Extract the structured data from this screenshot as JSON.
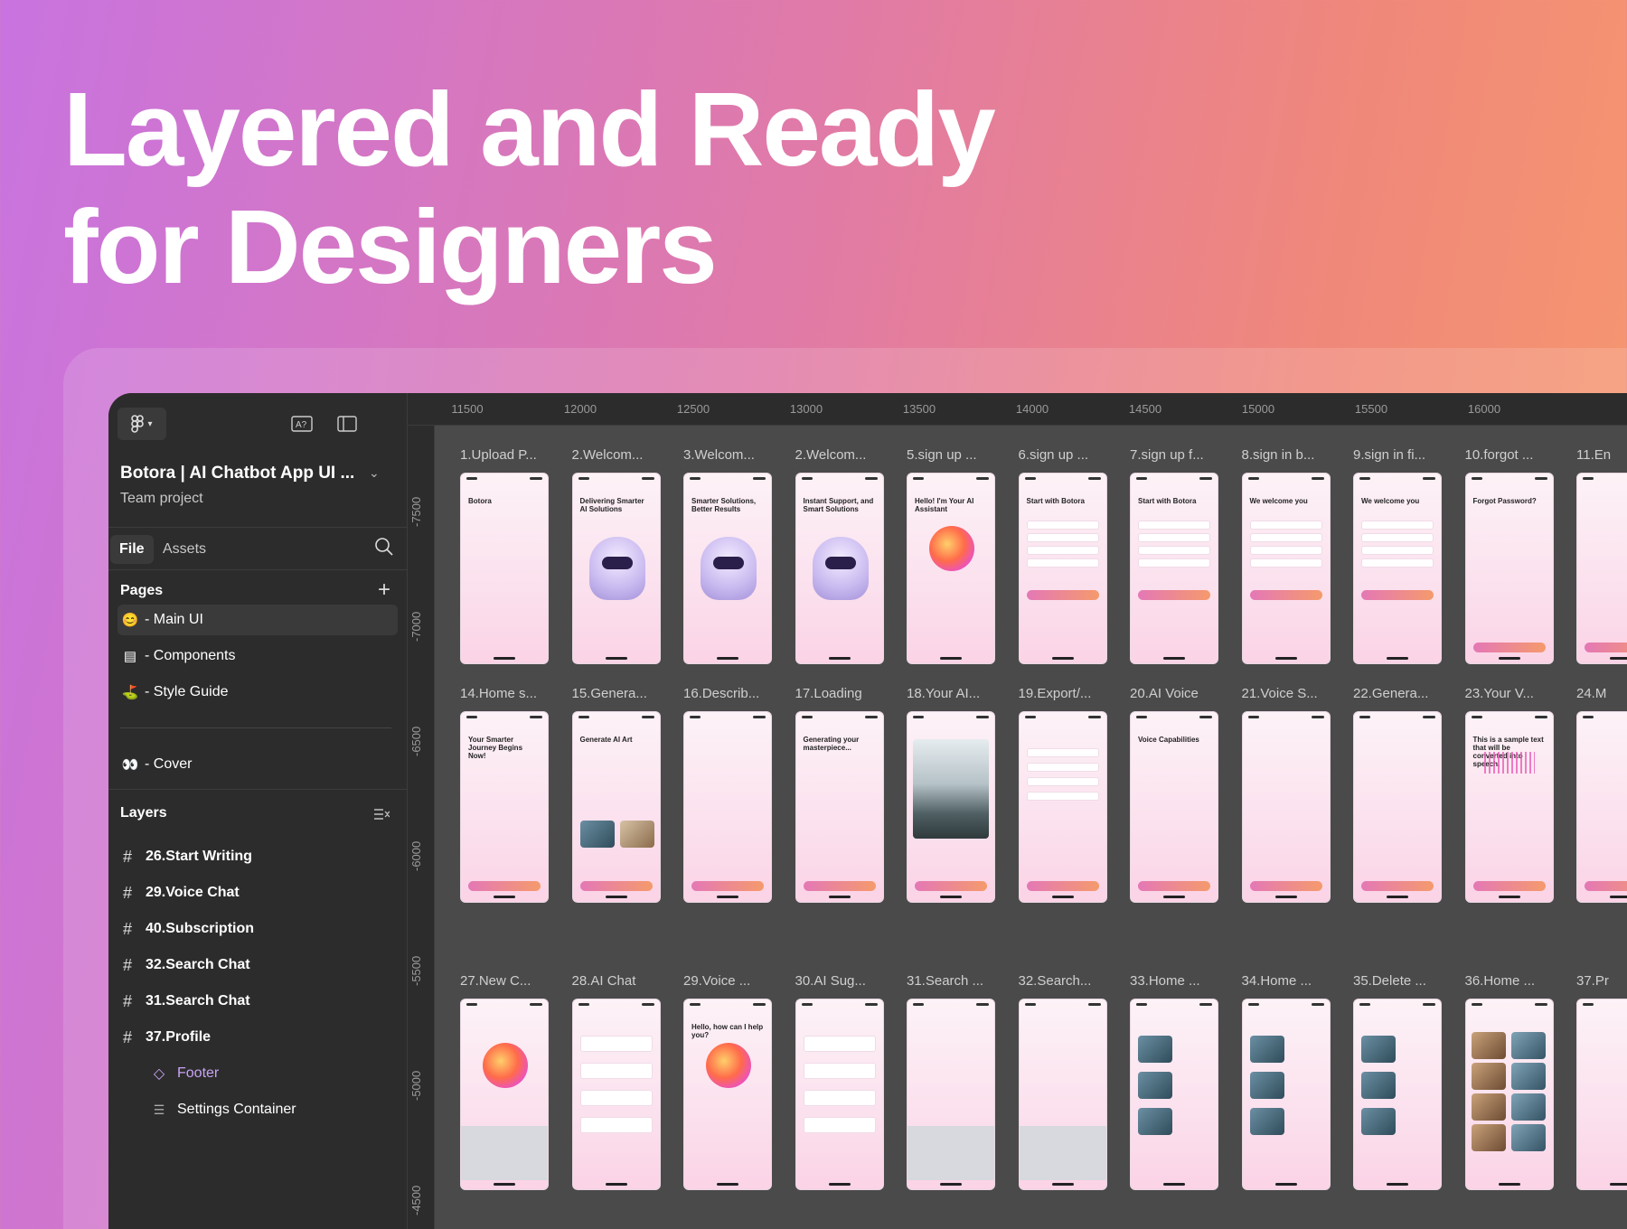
{
  "headline": {
    "line1": "Layered and Ready",
    "line2": "for Designers"
  },
  "sidebar": {
    "project_name": "Botora | AI Chatbot App UI ...",
    "project_team": "Team project",
    "tabs": {
      "file": "File",
      "assets": "Assets"
    },
    "pages_title": "Pages",
    "pages": [
      {
        "emoji": "😊",
        "label": "- Main UI"
      },
      {
        "emoji": "▤",
        "label": "- Components"
      },
      {
        "emoji": "⛳",
        "label": "- Style Guide"
      },
      {
        "emoji": "👀",
        "label": "- Cover"
      }
    ],
    "layers_title": "Layers",
    "layers": [
      {
        "label": "26.Start Writing"
      },
      {
        "label": "29.Voice Chat"
      },
      {
        "label": "40.Subscription"
      },
      {
        "label": "32.Search Chat"
      },
      {
        "label": "31.Search Chat"
      },
      {
        "label": "37.Profile"
      },
      {
        "label": "Footer"
      },
      {
        "label": "Settings Container"
      }
    ]
  },
  "ruler": {
    "x_ticks": [
      "11500",
      "12000",
      "12500",
      "13000",
      "13500",
      "14000",
      "14500",
      "15000",
      "15500",
      "16000"
    ],
    "y_ticks": [
      "-7500",
      "-7000",
      "-6500",
      "-6000",
      "-5500",
      "-5000",
      "-4500"
    ]
  },
  "frames": {
    "row1": [
      "1.Upload P...",
      "2.Welcom...",
      "3.Welcom...",
      "2.Welcom...",
      "5.sign up ...",
      "6.sign up ...",
      "7.sign up f...",
      "8.sign in b...",
      "9.sign in fi...",
      "10.forgot ...",
      "11.En"
    ],
    "row2": [
      "14.Home s...",
      "15.Genera...",
      "16.Describ...",
      "17.Loading",
      "18.Your AI...",
      "19.Export/...",
      "20.AI Voice",
      "21.Voice S...",
      "22.Genera...",
      "23.Your V...",
      "24.M"
    ],
    "row3": [
      "27.New C...",
      "28.AI Chat",
      "29.Voice ...",
      "30.AI Sug...",
      "31.Search ...",
      "32.Search...",
      "33.Home ...",
      "34.Home ...",
      "35.Delete ...",
      "36.Home ...",
      "37.Pr"
    ]
  },
  "phone_titles": {
    "row1": [
      "Botora",
      "Delivering Smarter AI Solutions",
      "Smarter Solutions, Better Results",
      "Instant Support, and Smart Solutions",
      "Hello! I'm Your AI Assistant",
      "Start with Botora",
      "Start with Botora",
      "We welcome you",
      "We welcome you",
      "Forgot Password?",
      ""
    ],
    "row2": [
      "Your Smarter Journey Begins Now!",
      "Generate AI Art",
      "",
      "Generating your masterpiece...",
      "",
      "",
      "Voice Capabilities",
      "",
      "",
      "This is a sample text that will be converted into speech.",
      ""
    ],
    "row3": [
      "",
      "",
      "Hello, how can I help you?",
      "",
      "",
      "",
      "",
      "",
      "",
      "",
      ""
    ]
  },
  "colors": {
    "accent_gradient_start": "#e478b6",
    "accent_gradient_end": "#f59a6c",
    "sidebar_bg": "#2c2c2c",
    "canvas_bg": "#4a4a4a",
    "purple_layer": "#c7a4f5"
  }
}
